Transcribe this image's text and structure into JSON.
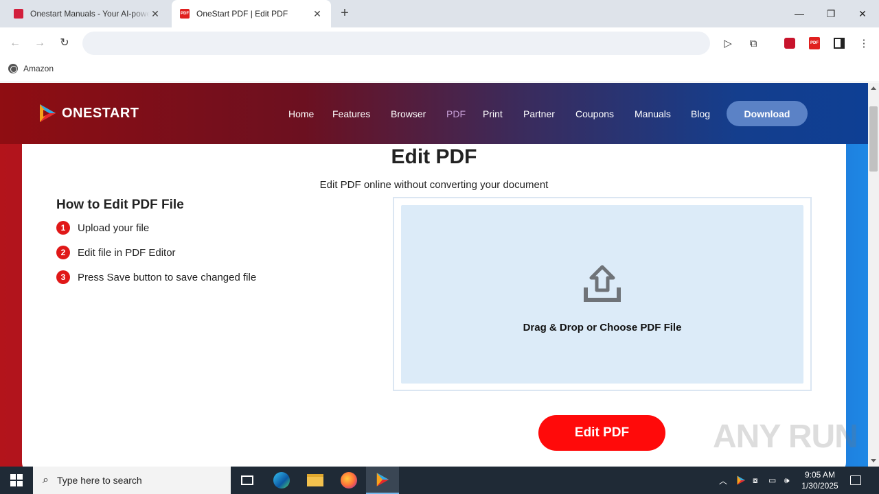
{
  "browser": {
    "tabs": [
      {
        "title": "Onestart Manuals - Your AI-powered",
        "active": false
      },
      {
        "title": "OneStart PDF | Edit PDF",
        "active": true
      }
    ],
    "address": "",
    "bookmarks": [
      {
        "label": "Amazon"
      }
    ]
  },
  "site": {
    "logo_text": "ONESTART",
    "nav": [
      "Home",
      "Features",
      "Browser",
      "PDF",
      "Print",
      "Partner",
      "Coupons",
      "Manuals",
      "Blog"
    ],
    "current_nav": "PDF",
    "download_label": "Download"
  },
  "page": {
    "title": "Edit PDF",
    "subtitle": "Edit PDF online without converting your document",
    "howto_title": "How to Edit PDF File",
    "steps": [
      {
        "num": "1",
        "text": "Upload your file"
      },
      {
        "num": "2",
        "text": "Edit file in PDF Editor"
      },
      {
        "num": "3",
        "text": "Press Save button to save changed file"
      }
    ],
    "drop_text": "Drag & Drop or Choose PDF File",
    "edit_button": "Edit PDF"
  },
  "watermark": "ANY RUN",
  "taskbar": {
    "search_placeholder": "Type here to search",
    "time": "9:05 AM",
    "date": "1/30/2025"
  },
  "colors": {
    "accent_red": "#ff0a0a",
    "dropzone_bg": "#dcebf8",
    "download_btn": "#5b82c6"
  }
}
